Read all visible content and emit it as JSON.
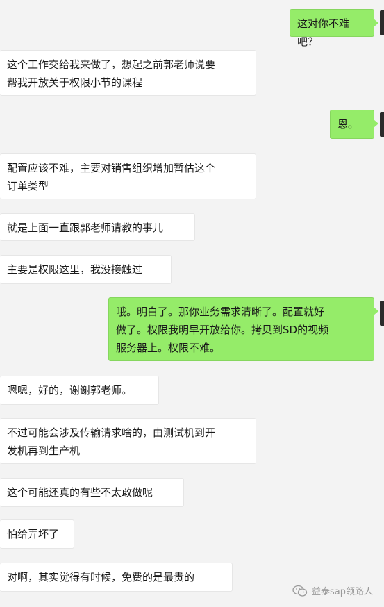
{
  "messages": [
    {
      "side": "right",
      "text": "这对你不难吧？"
    },
    {
      "side": "left",
      "text": "这个工作交给我来做了，想起之前郭老师说要\n帮我开放关于权限小节的课程"
    },
    {
      "side": "right",
      "text": "恩。"
    },
    {
      "side": "left",
      "text": "配置应该不难，主要对销售组织增加暂估这个\n订单类型"
    },
    {
      "side": "left",
      "text": "就是上面一直跟郭老师请教的事儿"
    },
    {
      "side": "left",
      "text": "主要是权限这里，我没接触过"
    },
    {
      "side": "right",
      "text": "哦。明白了。那你业务需求清晰了。配置就好\n做了。权限我明早开放给你。拷贝到SD的视频\n服务器上。权限不难。"
    },
    {
      "side": "left",
      "text": "嗯嗯，好的，谢谢郭老师。"
    },
    {
      "side": "left",
      "text": "不过可能会涉及传输请求啥的，由测试机到开\n发机再到生产机"
    },
    {
      "side": "left",
      "text": "这个可能还真的有些不太敢做呢"
    },
    {
      "side": "left",
      "text": "怕给弄坏了"
    },
    {
      "side": "left",
      "text": "对啊，其实觉得有时候，免费的是最贵的"
    }
  ],
  "watermark": {
    "icon": "wechat-icon",
    "text": "益泰sap领路人"
  }
}
